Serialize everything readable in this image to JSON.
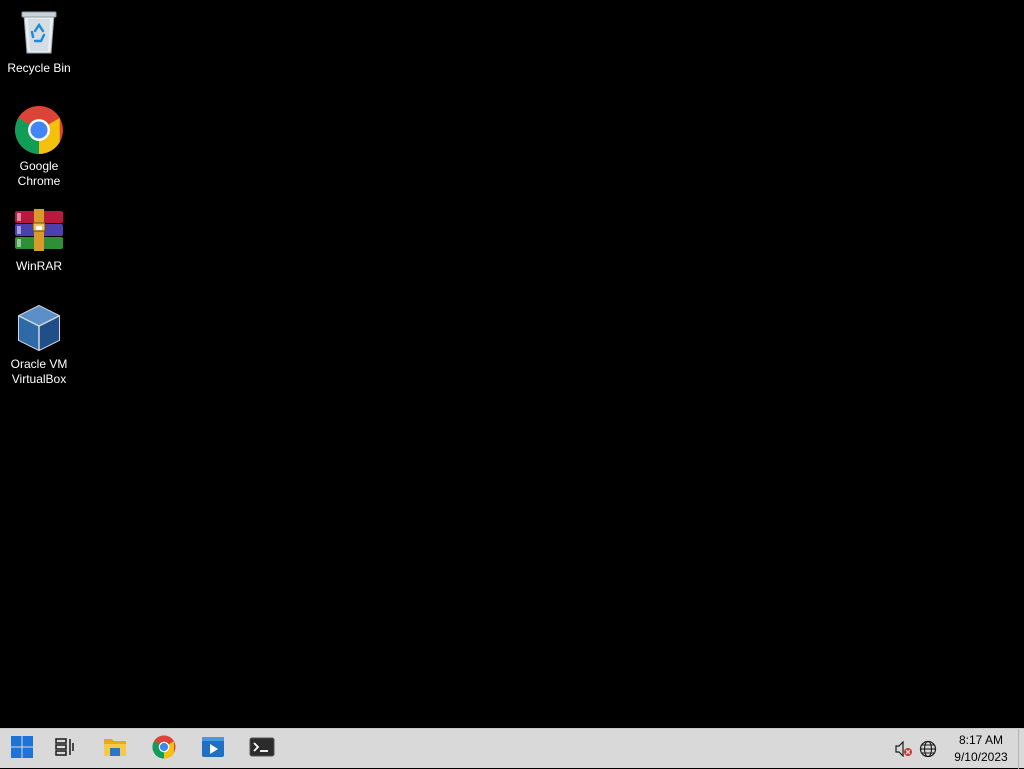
{
  "desktop": {
    "background": "#000000",
    "icons": [
      {
        "label": "Recycle Bin",
        "icon": "recycle-bin-icon"
      },
      {
        "label": "Google\nChrome",
        "icon": "chrome-icon"
      },
      {
        "label": "WinRAR",
        "icon": "winrar-icon"
      },
      {
        "label": "Oracle VM\nVirtualBox",
        "icon": "virtualbox-icon"
      }
    ]
  },
  "taskbar": {
    "background": "#d9d9d9",
    "pinned": [
      {
        "icon": "start-windows-icon"
      },
      {
        "icon": "task-view-icon"
      },
      {
        "icon": "file-explorer-icon"
      },
      {
        "icon": "chrome-icon"
      },
      {
        "icon": "media-app-icon"
      },
      {
        "icon": "terminal-icon"
      }
    ],
    "tray": {
      "volume_icon": "volume-muted-icon",
      "network_icon": "globe-network-icon",
      "time": "8:17 AM",
      "date": "9/10/2023"
    }
  },
  "colors": {
    "windows_blue": "#1e73d8",
    "chrome_red": "#db4437",
    "chrome_yellow": "#f4c20d",
    "chrome_green": "#0f9d58",
    "chrome_blue": "#4285f4"
  }
}
